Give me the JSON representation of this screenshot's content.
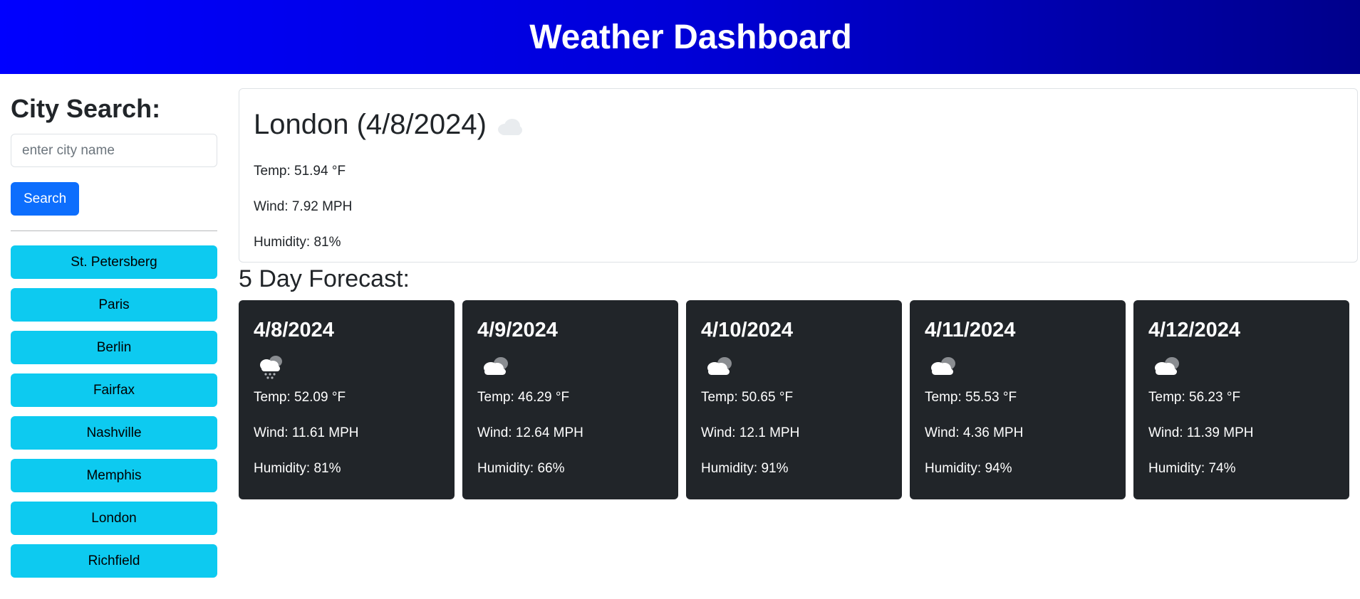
{
  "header": {
    "title": "Weather Dashboard"
  },
  "sidebar": {
    "heading": "City Search:",
    "search_placeholder": "enter city name",
    "search_value": "",
    "search_button": "Search",
    "cities": [
      "St. Petersberg",
      "Paris",
      "Berlin",
      "Fairfax",
      "Nashville",
      "Memphis",
      "London",
      "Richfield"
    ]
  },
  "current": {
    "title": "London (4/8/2024)",
    "icon": "cloud-icon",
    "temp": "Temp: 51.94 °F",
    "wind": "Wind: 7.92 MPH",
    "humidity": "Humidity: 81%"
  },
  "forecast": {
    "title": "5 Day Forecast:",
    "days": [
      {
        "date": "4/8/2024",
        "icon": "snow-cloud-icon",
        "temp": "Temp: 52.09 °F",
        "wind": "Wind: 11.61 MPH",
        "humidity": "Humidity: 81%"
      },
      {
        "date": "4/9/2024",
        "icon": "broken-clouds-icon",
        "temp": "Temp: 46.29 °F",
        "wind": "Wind: 12.64 MPH",
        "humidity": "Humidity: 66%"
      },
      {
        "date": "4/10/2024",
        "icon": "broken-clouds-icon",
        "temp": "Temp: 50.65 °F",
        "wind": "Wind: 12.1 MPH",
        "humidity": "Humidity: 91%"
      },
      {
        "date": "4/11/2024",
        "icon": "broken-clouds-icon",
        "temp": "Temp: 55.53 °F",
        "wind": "Wind: 4.36 MPH",
        "humidity": "Humidity: 94%"
      },
      {
        "date": "4/12/2024",
        "icon": "broken-clouds-icon",
        "temp": "Temp: 56.23 °F",
        "wind": "Wind: 11.39 MPH",
        "humidity": "Humidity: 74%"
      }
    ]
  },
  "colors": {
    "header_gradient_start": "#0000ff",
    "header_gradient_end": "#00008b",
    "search_button": "#0d6efd",
    "city_button": "#0dcaf0",
    "card_background": "#212529"
  }
}
